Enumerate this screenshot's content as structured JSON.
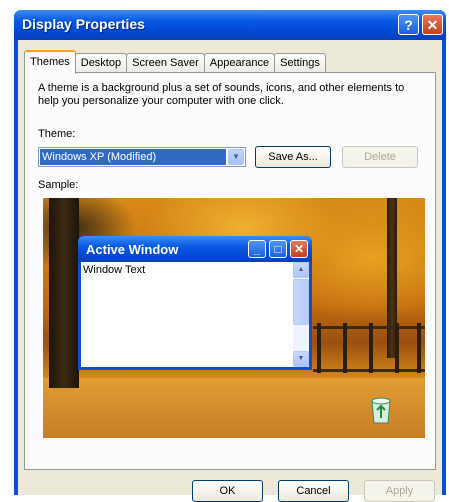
{
  "window": {
    "title": "Display Properties",
    "help_label": "?",
    "close_label": "✕"
  },
  "tabs": [
    {
      "label": "Themes",
      "active": true
    },
    {
      "label": "Desktop",
      "active": false
    },
    {
      "label": "Screen Saver",
      "active": false
    },
    {
      "label": "Appearance",
      "active": false
    },
    {
      "label": "Settings",
      "active": false
    }
  ],
  "themes_panel": {
    "description": "A theme is a background plus a set of sounds, icons, and other elements to help you personalize your computer with one click.",
    "theme_label": "Theme:",
    "theme_value": "Windows XP (Modified)",
    "save_as_label": "Save As...",
    "delete_label": "Delete",
    "sample_label": "Sample:"
  },
  "sample_window": {
    "title": "Active Window",
    "body_text": "Window Text",
    "min_glyph": "_",
    "max_glyph": "□",
    "close_glyph": "✕"
  },
  "footer": {
    "ok_label": "OK",
    "cancel_label": "Cancel",
    "apply_label": "Apply"
  },
  "colors": {
    "titlebar": "#0a4fd6",
    "selection": "#316ac5",
    "active_tab_accent": "#ff9d1d",
    "dialog_face": "#ece9d8"
  },
  "icons": [
    "help-icon",
    "close-icon",
    "dropdown-arrow-icon",
    "minimize-icon",
    "maximize-icon",
    "scroll-up-icon",
    "scroll-down-icon",
    "recycle-bin-icon"
  ]
}
